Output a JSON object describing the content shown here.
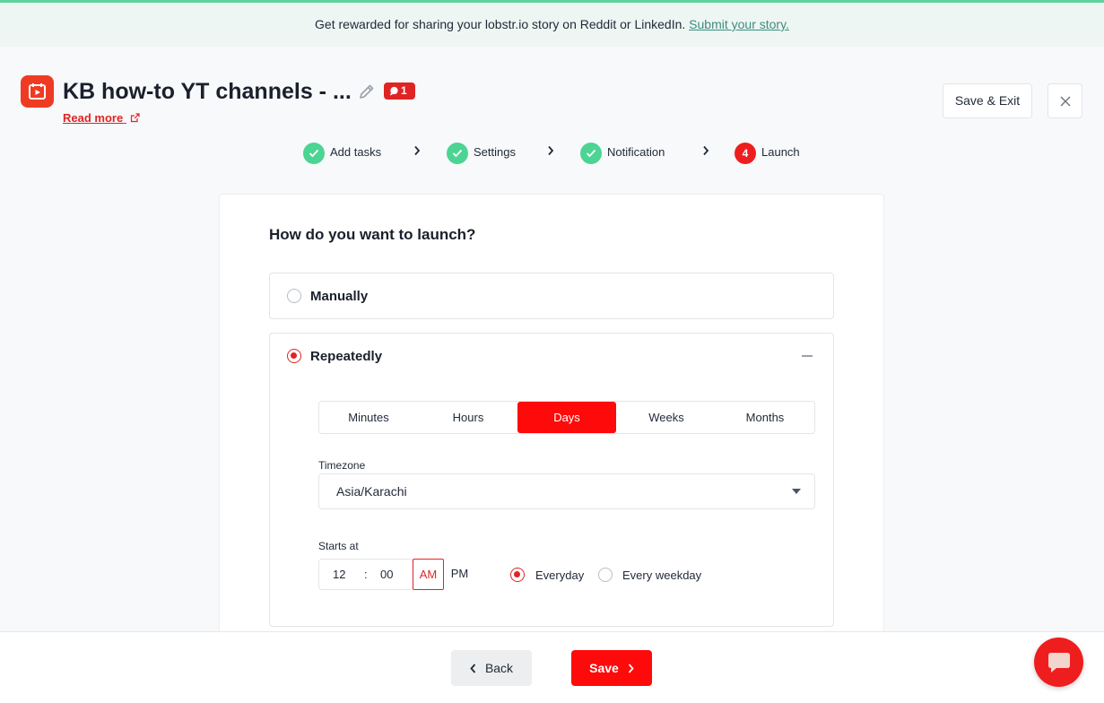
{
  "banner": {
    "text": "Get rewarded for sharing your lobstr.io story on Reddit or LinkedIn.",
    "link": "Submit your story."
  },
  "header": {
    "title": "KB how-to YT channels - ...",
    "badge_count": "1",
    "read_more": "Read more",
    "save_exit": "Save & Exit"
  },
  "steps": [
    {
      "label": "Add tasks",
      "state": "done"
    },
    {
      "label": "Settings",
      "state": "done"
    },
    {
      "label": "Notification",
      "state": "done"
    },
    {
      "label": "Launch",
      "state": "current",
      "number": "4"
    }
  ],
  "launch": {
    "question": "How do you want to launch?",
    "options": [
      {
        "label": "Manually",
        "selected": false
      },
      {
        "label": "Repeatedly",
        "selected": true
      }
    ],
    "intervals": [
      "Minutes",
      "Hours",
      "Days",
      "Weeks",
      "Months"
    ],
    "active_interval": "Days",
    "timezone_label": "Timezone",
    "timezone_value": "Asia/Karachi",
    "starts_at_label": "Starts at",
    "hour": "12",
    "separator": ":",
    "minute": "00",
    "am": "AM",
    "pm": "PM",
    "active_meridiem": "AM",
    "frequency": [
      {
        "label": "Everyday",
        "selected": true
      },
      {
        "label": "Every weekday",
        "selected": false
      }
    ]
  },
  "footer": {
    "back": "Back",
    "save": "Save"
  },
  "colors": {
    "accent": "#ff0a0a",
    "step_done": "#4cd493",
    "banner_bg": "#eef6f3",
    "link": "#3b8d7d"
  },
  "icons": {
    "app_logo": "youtube-calendar-icon",
    "edit": "pencil-icon",
    "badge": "comment-icon",
    "external": "external-link-icon",
    "close": "close-icon",
    "step_done": "check-icon",
    "step_separator": "chevron-right-icon",
    "collapse": "minus-icon",
    "dropdown": "caret-down-icon",
    "back": "chevron-left-icon",
    "chat": "chat-bubble-icon"
  }
}
